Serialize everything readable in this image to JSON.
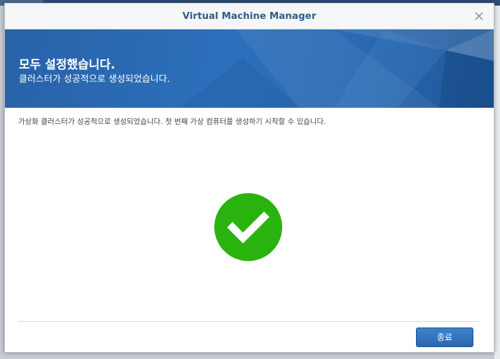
{
  "dialog": {
    "title": "Virtual Machine Manager",
    "close_icon": "close-icon"
  },
  "banner": {
    "title": "모두 설정했습니다.",
    "subtitle": "클러스터가 성공적으로 생성되었습니다.",
    "color": "#2a69b4"
  },
  "content": {
    "message": "가상화 클러스터가 성공적으로 생성되었습니다. 첫 번째 가상 컴퓨터를 생성하기 시작할 수 있습니다.",
    "status_icon": "checkmark-circle-icon",
    "status_color": "#2ab30e"
  },
  "footer": {
    "finish_label": "종료"
  }
}
